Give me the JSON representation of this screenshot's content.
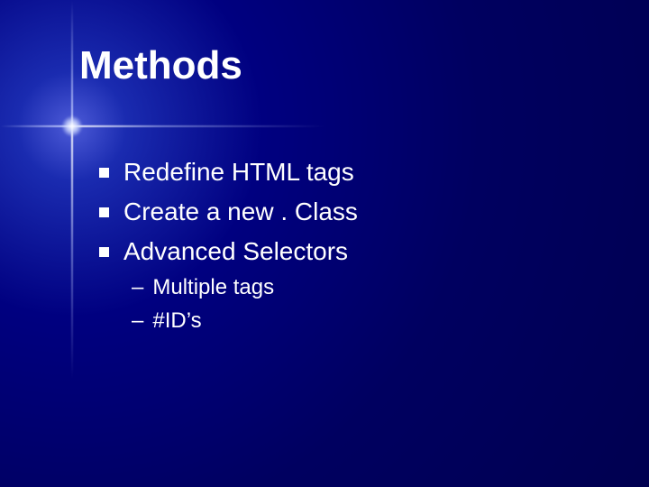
{
  "slide": {
    "title": "Methods",
    "bullets": [
      {
        "text": "Redefine HTML tags"
      },
      {
        "text": "Create a new . Class"
      },
      {
        "text": "Advanced Selectors"
      }
    ],
    "sub_bullets": [
      {
        "text": "Multiple tags"
      },
      {
        "text": "#ID’s"
      }
    ]
  }
}
